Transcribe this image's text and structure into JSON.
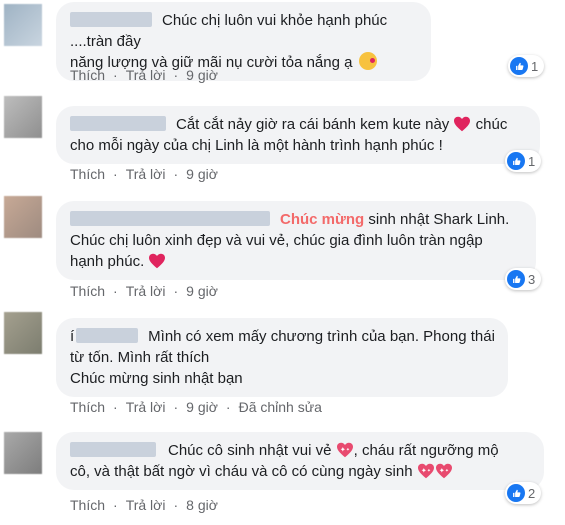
{
  "comments": [
    {
      "lines": [
        "Chúc chị luôn vui khỏe hạnh phúc ....tràn đầy",
        "năng lượng và giữ mãi nụ cười tỏa nắng ạ"
      ],
      "like": "Thích",
      "reply": "Trả lời",
      "time": "9 giờ",
      "reactions": "1"
    },
    {
      "line1_pre": "Cắt cắt nảy giờ ra cái bánh kem kute này",
      "line1_post": "chúc",
      "line2": "cho mỗi ngày của chị Linh là một hành trình hạnh phúc !",
      "like": "Thích",
      "reply": "Trả lời",
      "time": "9 giờ",
      "reactions": "1"
    },
    {
      "highlight": "Chúc mừng",
      "line1_rest": "sinh nhật Shark Linh.",
      "line2": "Chúc chị luôn xinh đẹp và vui vẻ, chúc gia đình luôn tràn ngập",
      "line3": "hạnh phúc.",
      "like": "Thích",
      "reply": "Trả lời",
      "time": "9 giờ",
      "reactions": "3"
    },
    {
      "name_fragment": "í",
      "line1": "Mình có xem mấy chương trình của bạn. Phong thái",
      "line2": "từ tốn. Mình rất thích",
      "line3": "Chúc mừng sinh nhật bạn",
      "like": "Thích",
      "reply": "Trả lời",
      "time": "9 giờ",
      "edited": "Đã chỉnh sửa"
    },
    {
      "line1_pre": "Chúc cô sinh nhật vui vẻ",
      "line1_post": ", cháu rất ngưỡng mộ",
      "line2": "cô, và thật bất ngờ vì cháu và cô có cùng ngày sinh",
      "like": "Thích",
      "reply": "Trả lời",
      "time": "8 giờ",
      "reactions": "2"
    }
  ],
  "colors": {
    "like_blue": "#1877f2",
    "bubble": "#f2f3f5",
    "highlight": "#f36a6a",
    "meta": "#65676b"
  },
  "icons": {
    "like": "like-thumb-icon",
    "heart": "red-heart-icon",
    "sparkle_heart": "sparkling-heart-icon",
    "kiss": "kissing-face-icon"
  }
}
